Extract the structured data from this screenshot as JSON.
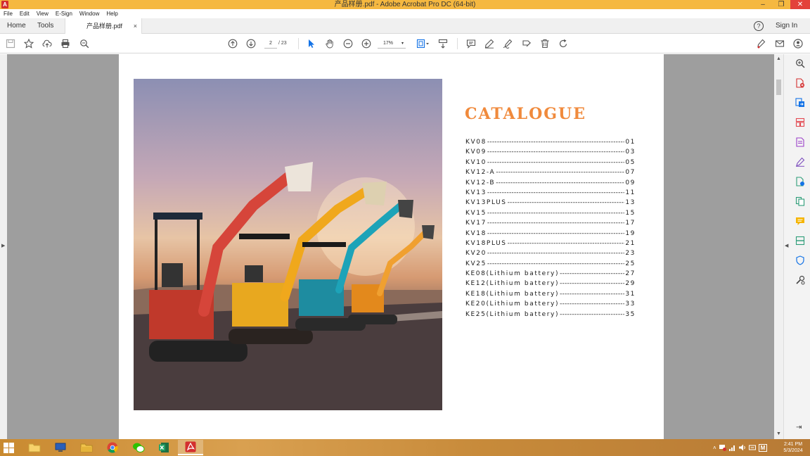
{
  "window": {
    "title": "产品样册.pdf - Adobe Acrobat Pro DC (64-bit)",
    "app_logo": "A",
    "controls": {
      "minimize": "–",
      "maximize": "❐",
      "close": "✕"
    }
  },
  "menu": [
    "File",
    "Edit",
    "View",
    "E-Sign",
    "Window",
    "Help"
  ],
  "tabs": {
    "home": "Home",
    "tools": "Tools",
    "document": "产品样册.pdf",
    "close": "×",
    "help": "?",
    "sign_in": "Sign In"
  },
  "toolbar": {
    "page_current": "2",
    "page_total": "/ 23",
    "zoom": "17%",
    "zoom_caret": "▾"
  },
  "document": {
    "catalogue_title": "CATALOGUE",
    "toc": [
      {
        "label": "KV08",
        "page": "01"
      },
      {
        "label": "KV09",
        "page": "03"
      },
      {
        "label": "KV10",
        "page": "05"
      },
      {
        "label": "KV12-A",
        "page": "07"
      },
      {
        "label": "KV12-B",
        "page": "09"
      },
      {
        "label": "KV13",
        "page": "11"
      },
      {
        "label": "KV13PLUS",
        "page": "13"
      },
      {
        "label": "KV15",
        "page": "15"
      },
      {
        "label": "KV17",
        "page": "17"
      },
      {
        "label": "KV18",
        "page": "19"
      },
      {
        "label": "KV18PLUS",
        "page": "21"
      },
      {
        "label": "KV20",
        "page": "23"
      },
      {
        "label": "KV25",
        "page": "25"
      },
      {
        "label": "KE08(Lithium battery)",
        "page": "27"
      },
      {
        "label": "KE12(Lithium battery)",
        "page": "29"
      },
      {
        "label": "KE18(Lithium battery)",
        "page": "31"
      },
      {
        "label": "KE20(Lithium battery)",
        "page": "33"
      },
      {
        "label": "KE25(Lithium battery)",
        "page": "35"
      }
    ]
  },
  "panes": {
    "left_arrow": "▶",
    "right_arrow": "◀",
    "scroll_up": "▲",
    "scroll_down": "▼",
    "collapse_tools": "⇥"
  },
  "taskbar": {
    "tray_arrow": "˄",
    "ime": "M",
    "time": "2:41 PM",
    "date": "5/3/2024"
  },
  "colors": {
    "titlebar": "#f5b840",
    "accent_title": "#f08a3c",
    "close_button": "#e3423a",
    "acrobat_red": "#d32f2f"
  }
}
